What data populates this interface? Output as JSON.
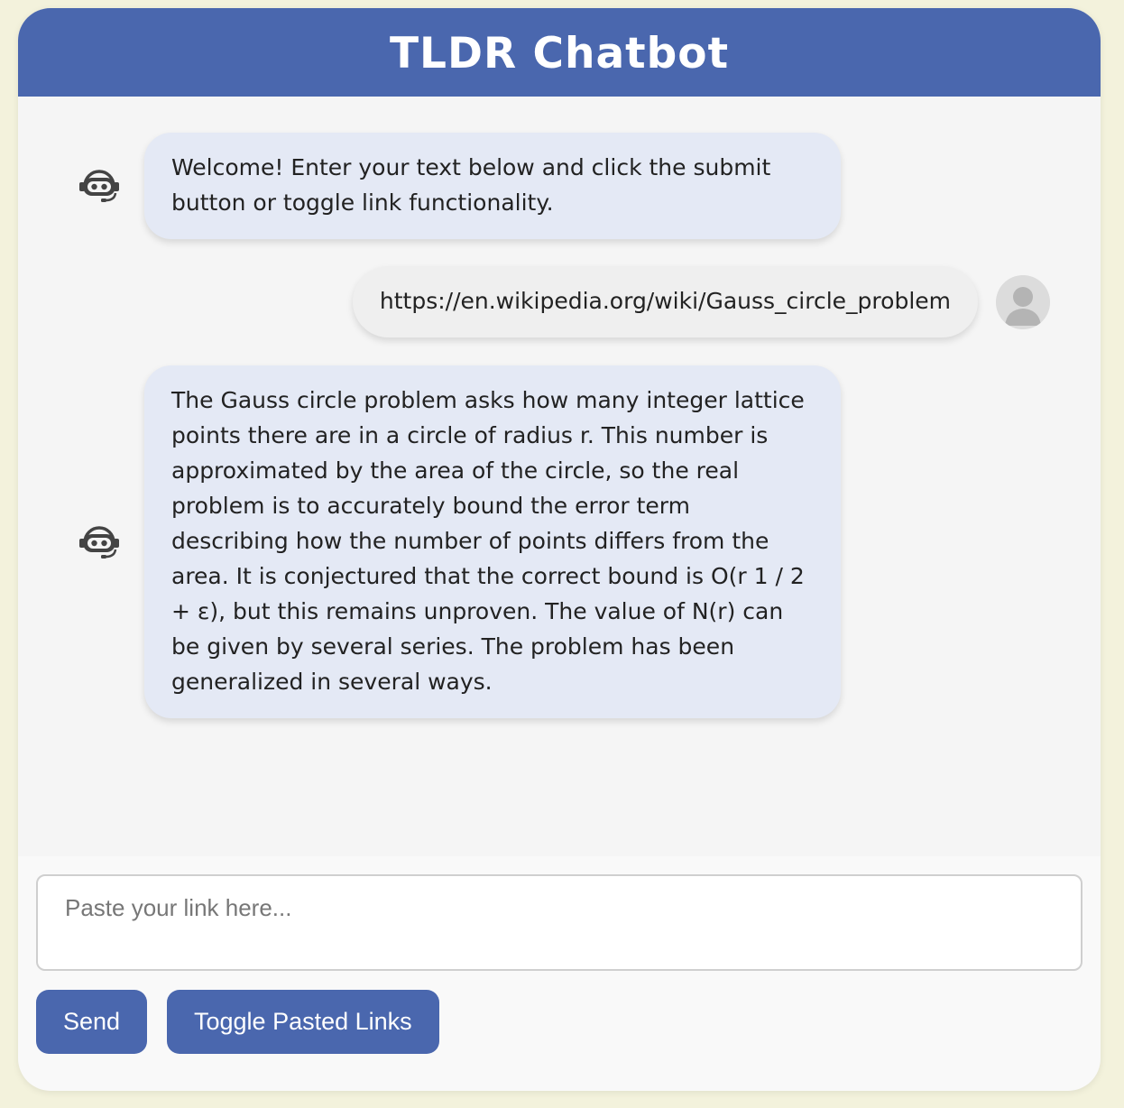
{
  "header": {
    "title": "TLDR Chatbot"
  },
  "messages": [
    {
      "sender": "bot",
      "text": "Welcome! Enter your text below and click the submit button or toggle link functionality."
    },
    {
      "sender": "user",
      "text": "https://en.wikipedia.org/wiki/Gauss_circle_problem"
    },
    {
      "sender": "bot",
      "text": "The Gauss circle problem asks how many integer lattice points there are in a circle of radius r. This number is approximated by the area of the circle, so the real problem is to accurately bound the error term describing how the number of points differs from the area. It is conjectured that the correct bound is O(r 1 / 2 + ε), but this remains unproven. The value of N(r) can be given by several series. The problem has been generalized in several ways."
    }
  ],
  "composer": {
    "placeholder": "Paste your link here...",
    "value": ""
  },
  "buttons": {
    "send_label": "Send",
    "toggle_label": "Toggle Pasted Links"
  },
  "colors": {
    "accent": "#4a67ae",
    "page_background": "#f3f2dc",
    "bot_bubble": "#e4e9f5",
    "user_bubble": "#efefef"
  },
  "icons": {
    "bot": "robot-headset-icon",
    "user": "user-silhouette-icon"
  }
}
